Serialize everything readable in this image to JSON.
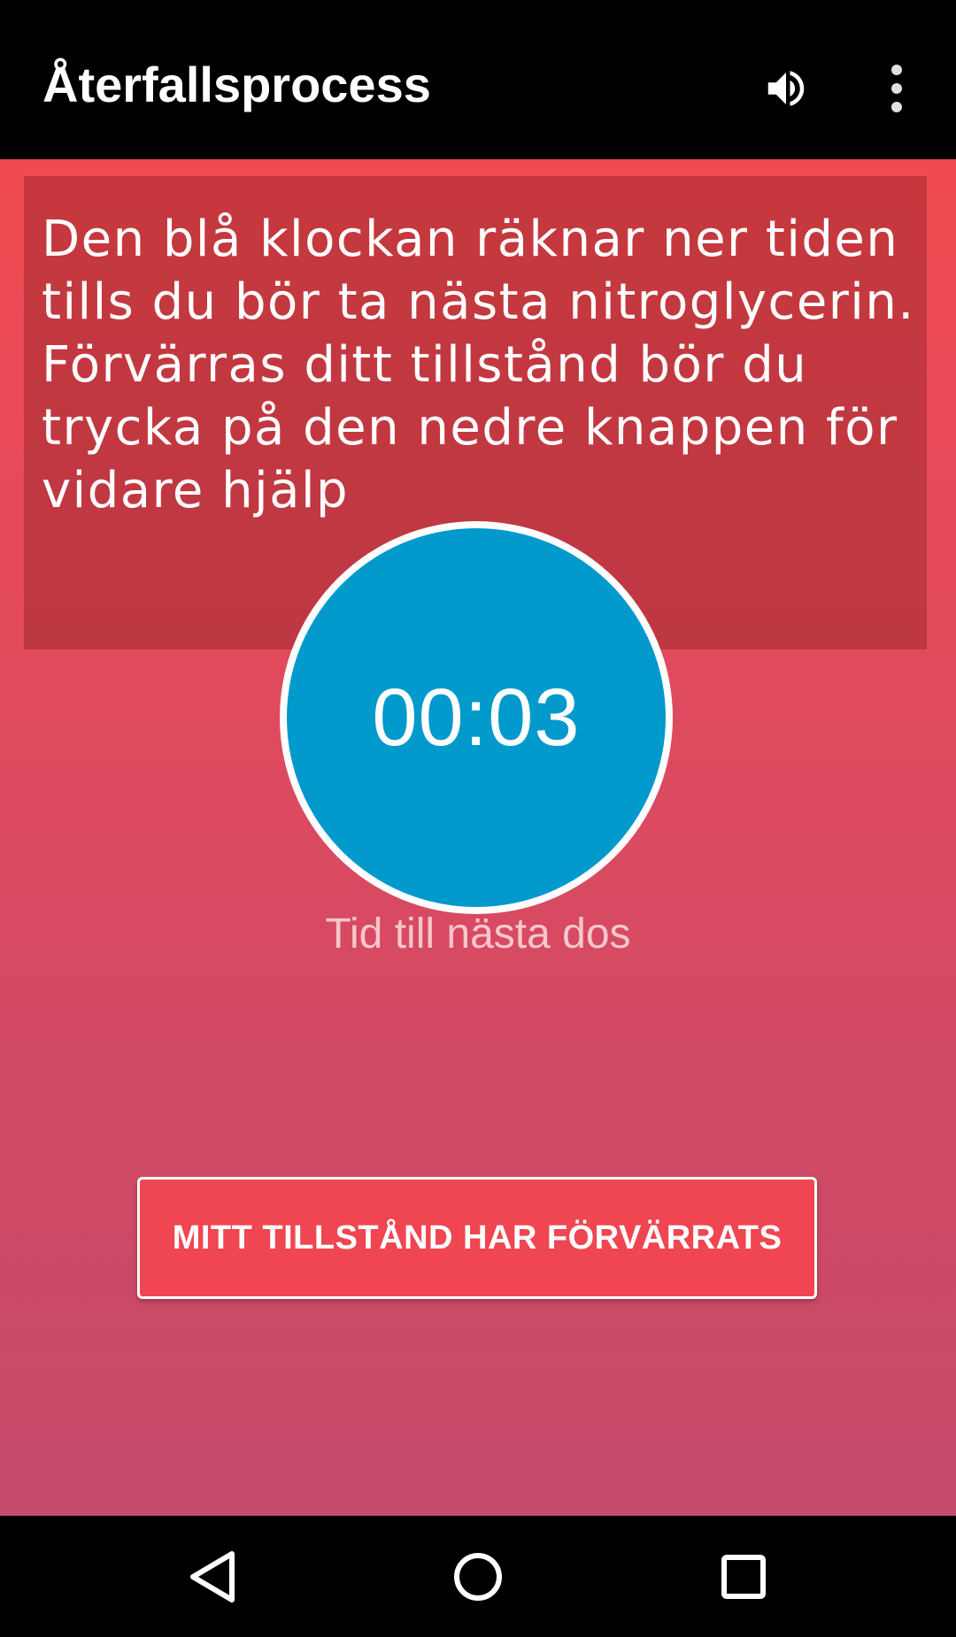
{
  "app_bar": {
    "title": "Återfallsprocess",
    "actions": [
      {
        "icon": "volume-up-icon"
      },
      {
        "icon": "overflow-menu-icon"
      }
    ]
  },
  "info": {
    "text": "Den blå klockan räknar ner tiden tills du bör ta nästa nitroglycerin. Förvärras ditt tillstånd bör du trycka på den nedre knappen för vidare hjälp"
  },
  "timer": {
    "value": "00:03",
    "caption": "Tid till nästa dos"
  },
  "actions": {
    "worse_button": "MITT TILLSTÅND HAR FÖRVÄRRATS"
  },
  "nav_bar": {
    "buttons": [
      {
        "icon": "back-triangle-icon"
      },
      {
        "icon": "home-circle-icon"
      },
      {
        "icon": "recents-square-icon"
      }
    ]
  },
  "colors": {
    "app_bar": "#000000",
    "background_top": "#f04a50",
    "background_bottom": "#c54b6c",
    "timer_circle": "#0299cd",
    "button": "#ef4651"
  }
}
